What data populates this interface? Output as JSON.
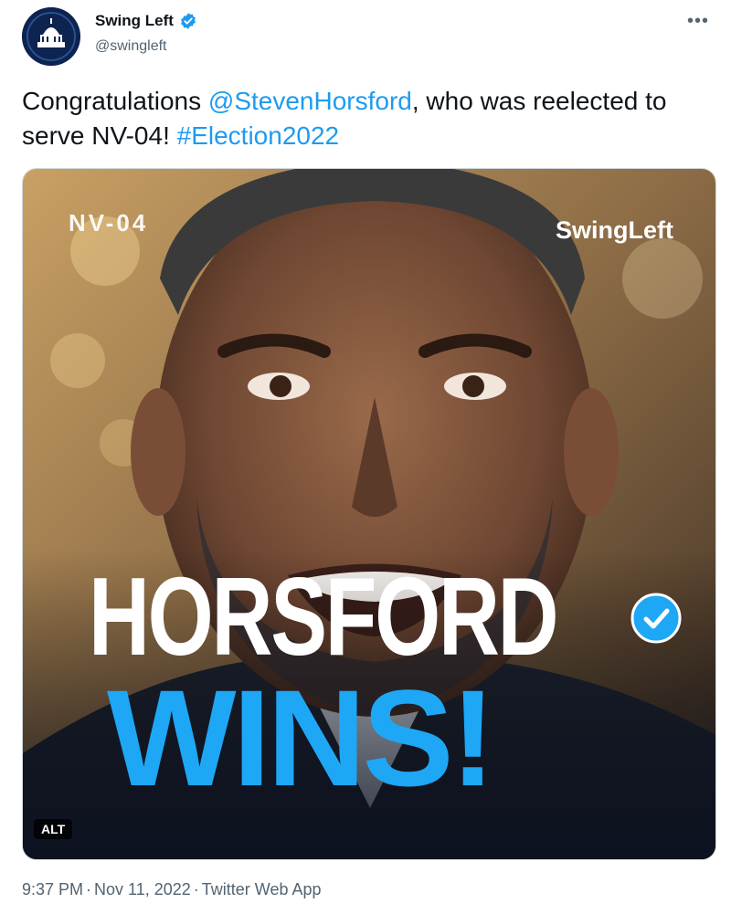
{
  "author": {
    "display_name": "Swing Left",
    "handle": "@swingleft",
    "verified": true
  },
  "more_icon": "•••",
  "tweet": {
    "text_part1": "Congratulations ",
    "mention": "@StevenHorsford",
    "text_part2": ", who was reelected to serve NV-04! ",
    "hashtag": "#Election2022"
  },
  "media": {
    "region_label": "NV-04",
    "brand": "SwingLeft",
    "headline_line1": "HORSFORD",
    "headline_line2": "WINS!",
    "alt_badge": "ALT"
  },
  "footer": {
    "time": "9:37 PM",
    "date": "Nov 11, 2022",
    "source": "Twitter Web App",
    "separator": "·"
  },
  "colors": {
    "link": "#1d9bf0",
    "verified": "#1d9bf0",
    "headline_accent": "#1ea7f5",
    "secondary_text": "#536471"
  }
}
